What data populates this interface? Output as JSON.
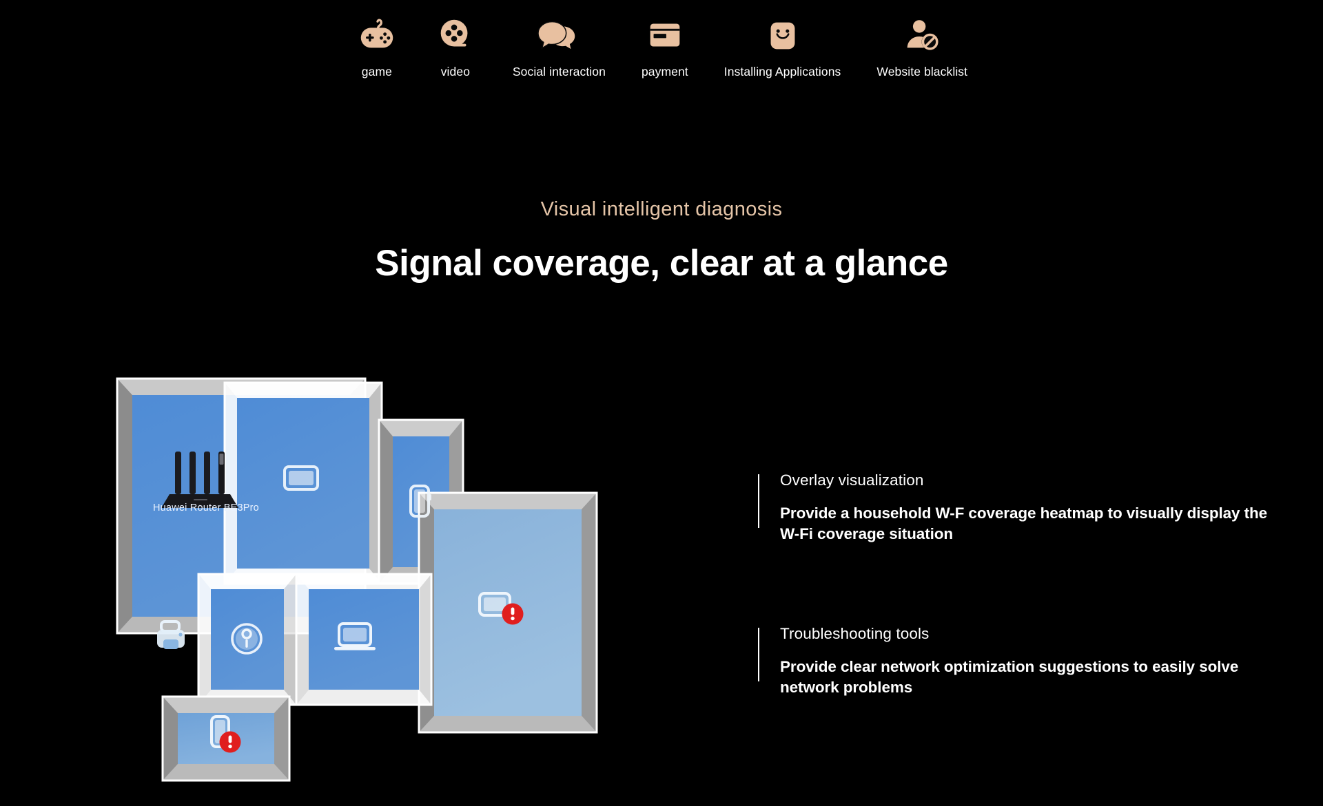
{
  "nav": {
    "items": [
      {
        "label": "game",
        "icon": "gamepad-icon"
      },
      {
        "label": "video",
        "icon": "film-reel-icon"
      },
      {
        "label": "Social interaction",
        "icon": "chat-bubbles-icon"
      },
      {
        "label": "payment",
        "icon": "credit-card-icon"
      },
      {
        "label": "Installing Applications",
        "icon": "app-gallery-bag-icon"
      },
      {
        "label": "Website blacklist",
        "icon": "user-blocked-icon"
      }
    ]
  },
  "hero": {
    "eyebrow": "Visual intelligent diagnosis",
    "headline": "Signal coverage, clear at a glance"
  },
  "floorplan": {
    "router_label": "Huawei Router BE3Pro",
    "devices": [
      {
        "name": "router",
        "room": "living-room",
        "status": "ok"
      },
      {
        "name": "tv",
        "room": "bedroom-1",
        "status": "ok"
      },
      {
        "name": "phone",
        "room": "bedroom-2",
        "status": "ok"
      },
      {
        "name": "printer",
        "room": "living-room",
        "status": "ok"
      },
      {
        "name": "robot-vacuum",
        "room": "bathroom",
        "status": "ok"
      },
      {
        "name": "laptop",
        "room": "study",
        "status": "ok"
      },
      {
        "name": "tablet",
        "room": "right-room",
        "status": "warning"
      },
      {
        "name": "phone",
        "room": "bottom-room",
        "status": "warning"
      }
    ]
  },
  "features": [
    {
      "title": "Overlay visualization",
      "desc": "Provide a household W-F coverage heatmap to visually display the W-Fi coverage situation"
    },
    {
      "title": "Troubleshooting tools",
      "desc": "Provide clear network optimization suggestions to easily solve network problems"
    }
  ],
  "colors": {
    "background": "#000000",
    "icon_beige": "#e8c0a0",
    "eyebrow": "#e5c5a8",
    "floor_strong": "#4e8ad4",
    "floor_weak": "#8db4d9",
    "wall_top": "#c8c8c8",
    "wall_side": "#8a8a8a",
    "warning_red": "#e62020",
    "accent_bar": "#ffffff"
  }
}
